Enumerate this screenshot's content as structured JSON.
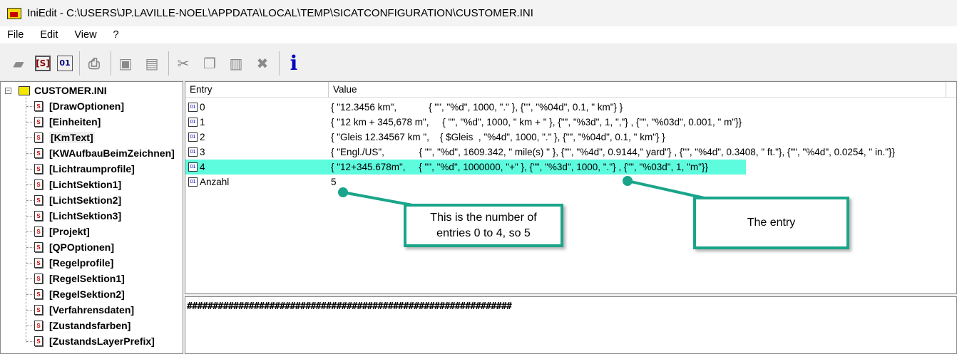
{
  "window": {
    "title": "IniEdit - C:\\USERS\\JP.LAVILLE-NOEL\\APPDATA\\LOCAL\\TEMP\\SICATCONFIGURATION\\CUSTOMER.INI"
  },
  "menu": [
    "File",
    "Edit",
    "View",
    "?"
  ],
  "toolbar": [
    "new-file-icon",
    "new-section-icon",
    "new-entry-icon",
    "open-icon",
    "save-icon",
    "save-all-icon",
    "cut-icon",
    "copy-icon",
    "paste-icon",
    "delete-icon",
    "info-icon"
  ],
  "tree": {
    "root": "CUSTOMER.INI",
    "sections": [
      "[DrawOptionen]",
      "[Einheiten]",
      "[KmText]",
      "[KWAufbauBeimZeichnen]",
      "[Lichtraumprofile]",
      "[LichtSektion1]",
      "[LichtSektion2]",
      "[LichtSektion3]",
      "[Projekt]",
      "[QPOptionen]",
      "[Regelprofile]",
      "[RegelSektion1]",
      "[RegelSektion2]",
      "[Verfahrensdaten]",
      "[Zustandsfarben]",
      "[ZustandsLayerPrefix]"
    ],
    "selected": "[KmText]"
  },
  "list": {
    "columns": [
      "Entry",
      "Value"
    ],
    "rows": [
      {
        "entry": "0",
        "value": "{ \"12.3456 km\",            { \"\", \"%d\", 1000, \".\" }, {\"\", \"%04d\", 0.1, \" km\"} }"
      },
      {
        "entry": "1",
        "value": "{ \"12 km + 345,678 m\",     { \"\", \"%d\", 1000, \" km + \" }, {\"\", \"%3d\", 1, \",\"} , {\"\", \"%03d\", 0.001, \" m\"}}"
      },
      {
        "entry": "2",
        "value": "{ \"Gleis 12.34567 km \",    { $Gleis  , \"%4d\", 1000, \".\" }, {\"\", \"%04d\", 0.1, \" km\"} }"
      },
      {
        "entry": "3",
        "value": "{ \"Engl./US\",             { \"\", \"%d\", 1609.342, \" mile(s) \" }, {\"\", \"%4d\", 0.9144,\" yard\"} , {\"\", \"%4d\", 0.3408, \" ft.\"}, {\"\", \"%4d\", 0.0254, \" in.\"}}"
      },
      {
        "entry": "4",
        "value": "{ \"12+345.678m\",     { \"\", \"%d\", 1000000, \"+\" }, {\"\", \"%3d\", 1000, \".\"} , {\"\", \"%03d\", 1, \"m\"}}"
      },
      {
        "entry": "Anzahl",
        "value": "5"
      }
    ],
    "selected_index": 4
  },
  "bottom": {
    "text": "###############################################################"
  },
  "callouts": {
    "count": "This is the number of entries 0 to 4, so 5",
    "entry": "The entry"
  },
  "colors": {
    "selection": "#5efcde",
    "callout_border": "#1aa58a"
  }
}
